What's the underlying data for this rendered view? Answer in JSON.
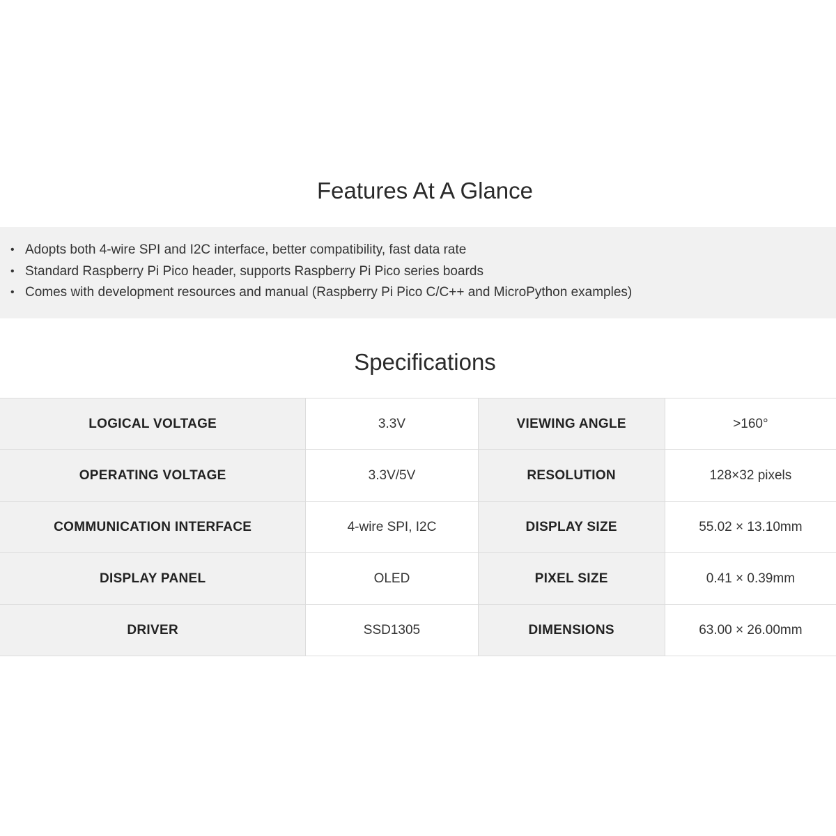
{
  "features": {
    "title": "Features At A Glance",
    "items": [
      "Adopts both 4-wire SPI and I2C interface, better compatibility, fast data rate",
      "Standard Raspberry Pi Pico header, supports Raspberry Pi Pico series boards",
      "Comes with development resources and manual (Raspberry Pi Pico C/C++ and MicroPython examples)"
    ],
    "bullet": "•"
  },
  "specifications": {
    "title": "Specifications",
    "rows": [
      {
        "label1": "LOGICAL VOLTAGE",
        "value1": "3.3V",
        "label2": "VIEWING ANGLE",
        "value2": ">160°"
      },
      {
        "label1": "OPERATING VOLTAGE",
        "value1": "3.3V/5V",
        "label2": "RESOLUTION",
        "value2": "128×32 pixels"
      },
      {
        "label1": "COMMUNICATION INTERFACE",
        "value1": "4-wire SPI, I2C",
        "label2": "DISPLAY SIZE",
        "value2": "55.02 × 13.10mm"
      },
      {
        "label1": "DISPLAY PANEL",
        "value1": "OLED",
        "label2": "PIXEL SIZE",
        "value2": "0.41 × 0.39mm"
      },
      {
        "label1": "DRIVER",
        "value1": "SSD1305",
        "label2": "DIMENSIONS",
        "value2": "63.00 × 26.00mm"
      }
    ]
  },
  "colors": {
    "background": "#ffffff",
    "panel": "#f1f1f1",
    "border": "#dcdcdc",
    "text": "#2b2b2b"
  }
}
